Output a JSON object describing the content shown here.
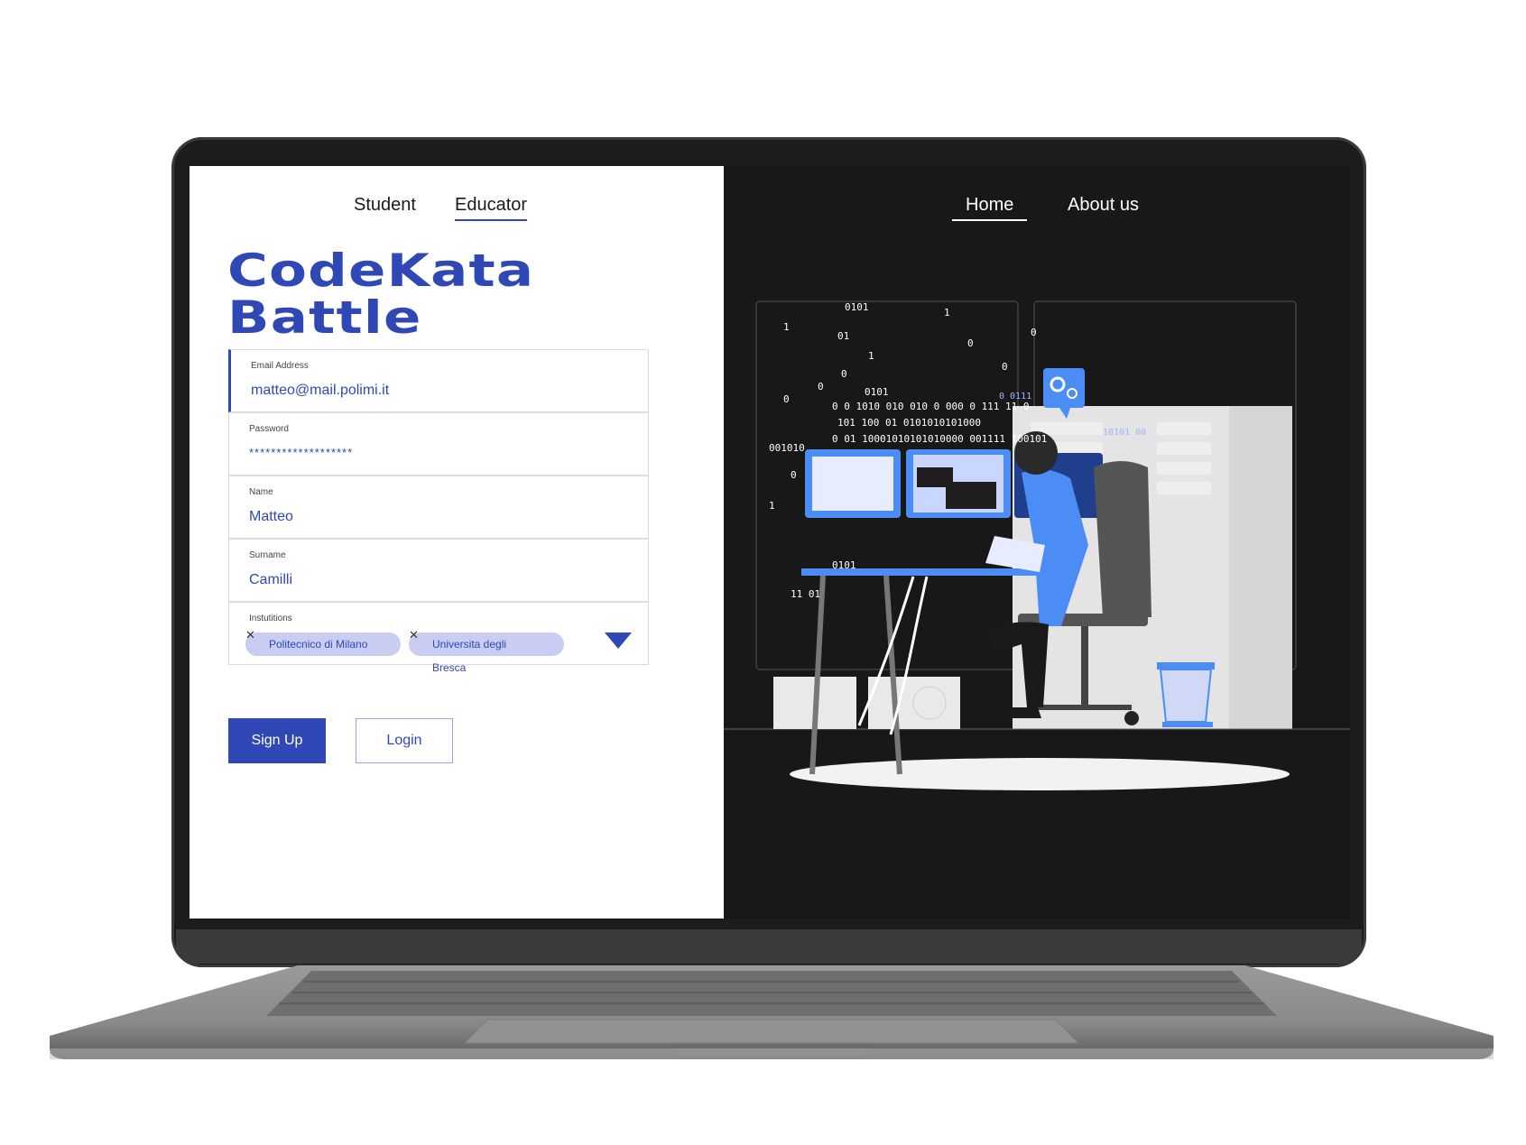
{
  "left_panel": {
    "tabs": [
      {
        "label": "Student"
      },
      {
        "label": "Educator"
      }
    ],
    "brand": {
      "line1": "CodeKata",
      "line2": "Battle"
    },
    "form": {
      "email": {
        "label": "Email Address",
        "value": "matteo@mail.polimi.it"
      },
      "password": {
        "label": "Password",
        "value": "*******************"
      },
      "name": {
        "label": "Name",
        "value": "Matteo"
      },
      "surname": {
        "label": "Surname",
        "value": "Camilli"
      },
      "institutions": {
        "label": "Instutitions",
        "chips": [
          "Politecnico di Milano",
          "Universita degli Bresca"
        ]
      }
    },
    "buttons": {
      "signup": "Sign Up",
      "login": "Login"
    }
  },
  "right_panel": {
    "nav": [
      {
        "label": "Home"
      },
      {
        "label": "About us"
      }
    ],
    "binary": {
      "a": "0101",
      "b": "1",
      "c": "01",
      "d": "0",
      "e": "0101",
      "f": "0 0  1010 010 010 0  000 0  111 11 0",
      "g": "101  100  01     0101010101000",
      "h": "0 01  10001010101010000  001111 100101",
      "i": "001010",
      "j": "0101",
      "k": "11 01",
      "l": "10101 00",
      "m": "0 0111"
    }
  },
  "colors": {
    "accent": "#2f48b5",
    "chip_bg": "#c9cdf2",
    "dark_panel": "#181818"
  },
  "icons": [
    "remove-chip-icon",
    "dropdown-caret-icon",
    "gears-icon"
  ]
}
